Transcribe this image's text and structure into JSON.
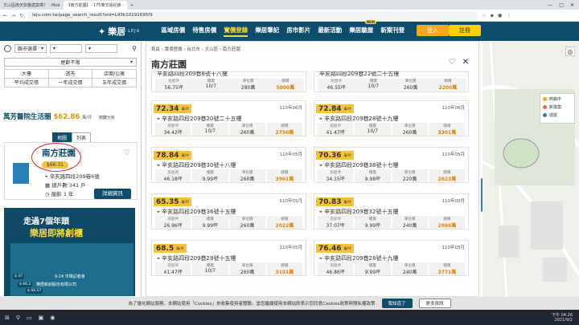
{
  "browser": {
    "tabs": [
      {
        "label": "文山區南天如養建案嗎？ - Mob"
      },
      {
        "label": "【南方莊園】- 175筆交易紀錄 -"
      }
    ],
    "url": "leju.com.tw/page_search_result?oid=L43b10191695f9"
  },
  "site": {
    "logo": "樂居",
    "logo_sub": "LEJU",
    "nav": [
      "區域房價",
      "待售房價",
      "實價登錄",
      "樂居筆記",
      "房市影片",
      "最新活動",
      "樂居驗屋",
      "新案刊登"
    ],
    "nav_active": "實價登錄",
    "new_badge": "NEW",
    "login": "登入",
    "register": "註冊"
  },
  "sidebar": {
    "county_select": "縣市選擇",
    "range_select": "屋齡不限",
    "filters": [
      "大樓",
      "透天",
      "店面/公寓",
      "平均成交價",
      "一年成交價",
      "五年成交價"
    ],
    "area_name": "萬芳醫院生活圈",
    "area_price": "$62.86",
    "area_unit": "萬/坪",
    "area_note": "按鍵分析",
    "tabs": [
      "地圖",
      "列表"
    ],
    "card": {
      "title": "南方莊園",
      "price": "$66.31",
      "address": "辛亥路四段209巷6號",
      "households": "總戶數 341 戶",
      "age": "屋齡 1 年",
      "detail_btn": "詳細資訊"
    },
    "ad": {
      "line1": "走過7個年頭",
      "line2": "樂居即將創櫃",
      "date": "9·24 市場記者會",
      "sub": "樂居新創股份有限公司"
    },
    "pins": [
      "$ 47",
      "$ 66.2",
      "$ 44.57"
    ]
  },
  "panel": {
    "breadcrumb": "首頁 › 實價登錄 › 台北市 › 文山區 › 南方莊園",
    "title": "南方莊園",
    "labels": {
      "unit": "萬/坪",
      "l1": "房屋坪",
      "l2": "樓層",
      "l3": "車位價",
      "l4": "總價"
    },
    "partial": [
      {
        "addr": "辛亥路四段209巷8號十八樓",
        "v": [
          "56.75坪",
          "10/7",
          "280萬",
          "5000萬"
        ]
      },
      {
        "addr": "辛亥路四段209巷22號二十五樓",
        "v": [
          "46.55坪",
          "10/7",
          "260萬",
          "2200萬"
        ]
      }
    ],
    "rows": [
      {
        "price": "72.34",
        "date": "110年06月",
        "addr": "辛亥路四段209巷20號二十五樓",
        "v": [
          "34.42坪",
          "10/7",
          "260萬",
          "2750萬"
        ]
      },
      {
        "price": "72.84",
        "date": "110年06月",
        "addr": "辛亥路四段209巷28號十九樓",
        "v": [
          "41.47坪",
          "10/7",
          "260萬",
          "3301萬"
        ]
      },
      {
        "price": "78.84",
        "date": "110年05月",
        "addr": "辛亥路四段209巷30號十八樓",
        "v": [
          "46.18坪",
          "9.99坪",
          "260萬",
          "3901萬"
        ]
      },
      {
        "price": "70.36",
        "date": "110年05月",
        "addr": "辛亥路四段209巷38號十七樓",
        "v": [
          "34.15坪",
          "9.98坪",
          "220萬",
          "2623萬"
        ]
      },
      {
        "price": "65.35",
        "date": "110年05月",
        "addr": "辛亥路四段209巷36號十五樓",
        "v": [
          "26.96坪",
          "9.99坪",
          "260萬",
          "2022萬"
        ]
      },
      {
        "price": "70.83",
        "date": "110年05月",
        "addr": "辛亥路四段209巷32號十五樓",
        "v": [
          "37.07坪",
          "9.99坪",
          "240萬",
          "2866萬"
        ]
      },
      {
        "price": "68.5",
        "date": "110年05月",
        "addr": "辛亥路四段209巷28號十五樓",
        "v": [
          "41.47坪",
          "10/7",
          "260萬",
          "3101萬"
        ]
      },
      {
        "price": "76.46",
        "date": "110年05月",
        "addr": "辛亥路四段209巷28號十九樓",
        "v": [
          "46.86坪",
          "9.99坪",
          "240萬",
          "3771萬"
        ]
      }
    ]
  },
  "map": {
    "legend": [
      {
        "label": "熱銷中",
        "color": "#f5a623"
      },
      {
        "label": "新建案",
        "color": "#e07040"
      },
      {
        "label": "成屋",
        "color": "#2a7fb8"
      }
    ]
  },
  "cookie": {
    "text": "為了優化網站服務，本網站使用「Cookies」來收集使用者體驗。當您繼續使用本網站即表示您同意Cookies政策與隱私權政策",
    "accept": "我知道了",
    "more": "更多資訊"
  },
  "taskbar": {
    "time": "下午 04:26",
    "date": "2021/9/2"
  }
}
